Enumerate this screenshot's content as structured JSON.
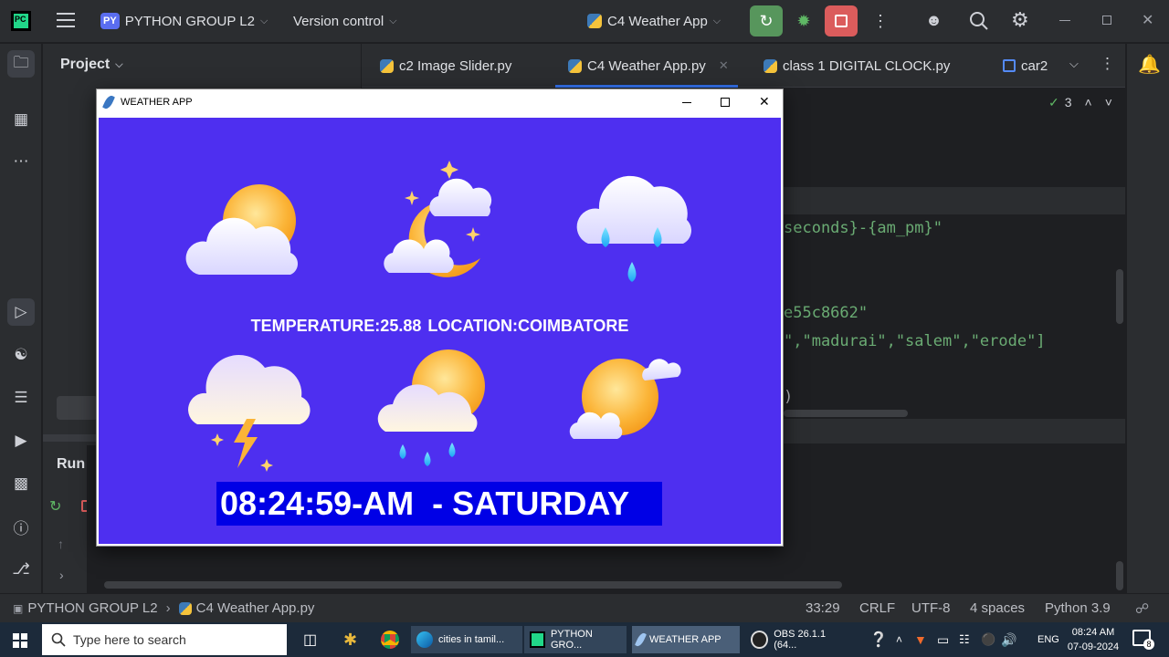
{
  "ide": {
    "logo": "PC",
    "project_badge": "PY",
    "project_name": "PYTHON GROUP L2",
    "vcs_label": "Version control",
    "run_config": "C4 Weather App",
    "panel_title": "Project",
    "run_label": "Run",
    "tabs": [
      {
        "label": "c2 Image Slider.py"
      },
      {
        "label": "C4 Weather App.py"
      },
      {
        "label": "class 1 DIGITAL CLOCK.py"
      },
      {
        "label": "car2"
      }
    ],
    "inspections_count": "3",
    "code_lines": [
      "seconds}-{am_pm}\"",
      "e55c8662\"",
      "\",\"madurai\",\"salem\",\"erode\"]",
      ")"
    ]
  },
  "status": {
    "breadcrumb_project": "PYTHON GROUP L2",
    "breadcrumb_file": "C4 Weather App.py",
    "position": "33:29",
    "line_sep": "CRLF",
    "encoding": "UTF-8",
    "indent": "4 spaces",
    "interpreter": "Python 3.9"
  },
  "weather_app": {
    "title": "WEATHER APP",
    "info_text": "TEMPERATURE:25.88  LOCATION:COIMBATORE",
    "clock_text": "08:24:59-AM  - SATURDAY",
    "bg_color": "#4e2ff0",
    "clock_bg": "#0000e6",
    "icons": [
      "sun-behind-cloud-icon",
      "moon-with-cloud-icon",
      "rain-cloud-icon",
      "thunder-cloud-icon",
      "sun-rain-cloud-icon",
      "sunny-icon"
    ]
  },
  "taskbar": {
    "search_placeholder": "Type here to search",
    "apps": [
      {
        "label": "cities in tamil..."
      },
      {
        "label": "PYTHON GRO..."
      },
      {
        "label": "WEATHER APP"
      },
      {
        "label": "OBS 26.1.1 (64..."
      }
    ],
    "lang": "ENG",
    "time": "08:24 AM",
    "date": "07-09-2024",
    "notifications": "8"
  }
}
